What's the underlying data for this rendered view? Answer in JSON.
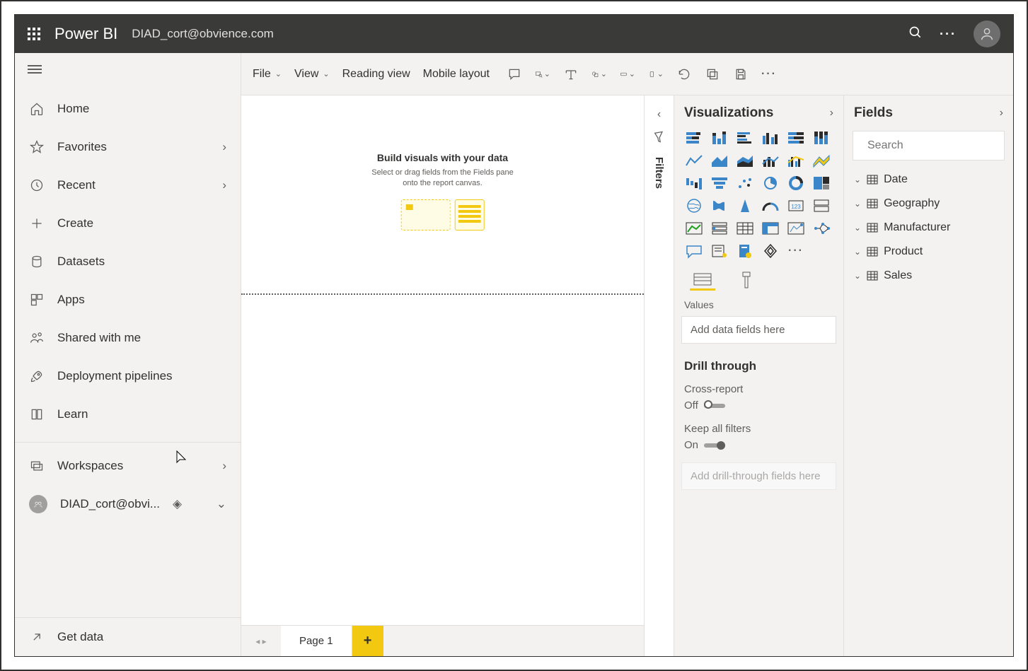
{
  "header": {
    "brand": "Power BI",
    "user": "DIAD_cort@obvience.com"
  },
  "nav": {
    "items": [
      {
        "label": "Home",
        "icon": "home"
      },
      {
        "label": "Favorites",
        "icon": "star",
        "expandable": true
      },
      {
        "label": "Recent",
        "icon": "clock",
        "expandable": true
      },
      {
        "label": "Create",
        "icon": "plus"
      },
      {
        "label": "Datasets",
        "icon": "db"
      },
      {
        "label": "Apps",
        "icon": "apps"
      },
      {
        "label": "Shared with me",
        "icon": "shared"
      },
      {
        "label": "Deployment pipelines",
        "icon": "rocket"
      },
      {
        "label": "Learn",
        "icon": "book"
      }
    ],
    "workspaces_label": "Workspaces",
    "current_workspace": "DIAD_cort@obvi...",
    "get_data": "Get data"
  },
  "ribbon": {
    "file": "File",
    "view": "View",
    "reading": "Reading view",
    "mobile": "Mobile layout"
  },
  "canvas": {
    "hint_title": "Build visuals with your data",
    "hint_sub1": "Select or drag fields from the Fields pane",
    "hint_sub2": "onto the report canvas."
  },
  "tabs": {
    "page1": "Page 1"
  },
  "filters_label": "Filters",
  "viz": {
    "title": "Visualizations",
    "values_label": "Values",
    "values_placeholder": "Add data fields here",
    "drill_title": "Drill through",
    "cross_report_label": "Cross-report",
    "cross_report_state": "Off",
    "keep_filters_label": "Keep all filters",
    "keep_filters_state": "On",
    "drill_placeholder": "Add drill-through fields here"
  },
  "fields": {
    "title": "Fields",
    "search_placeholder": "Search",
    "tables": [
      "Date",
      "Geography",
      "Manufacturer",
      "Product",
      "Sales"
    ]
  }
}
